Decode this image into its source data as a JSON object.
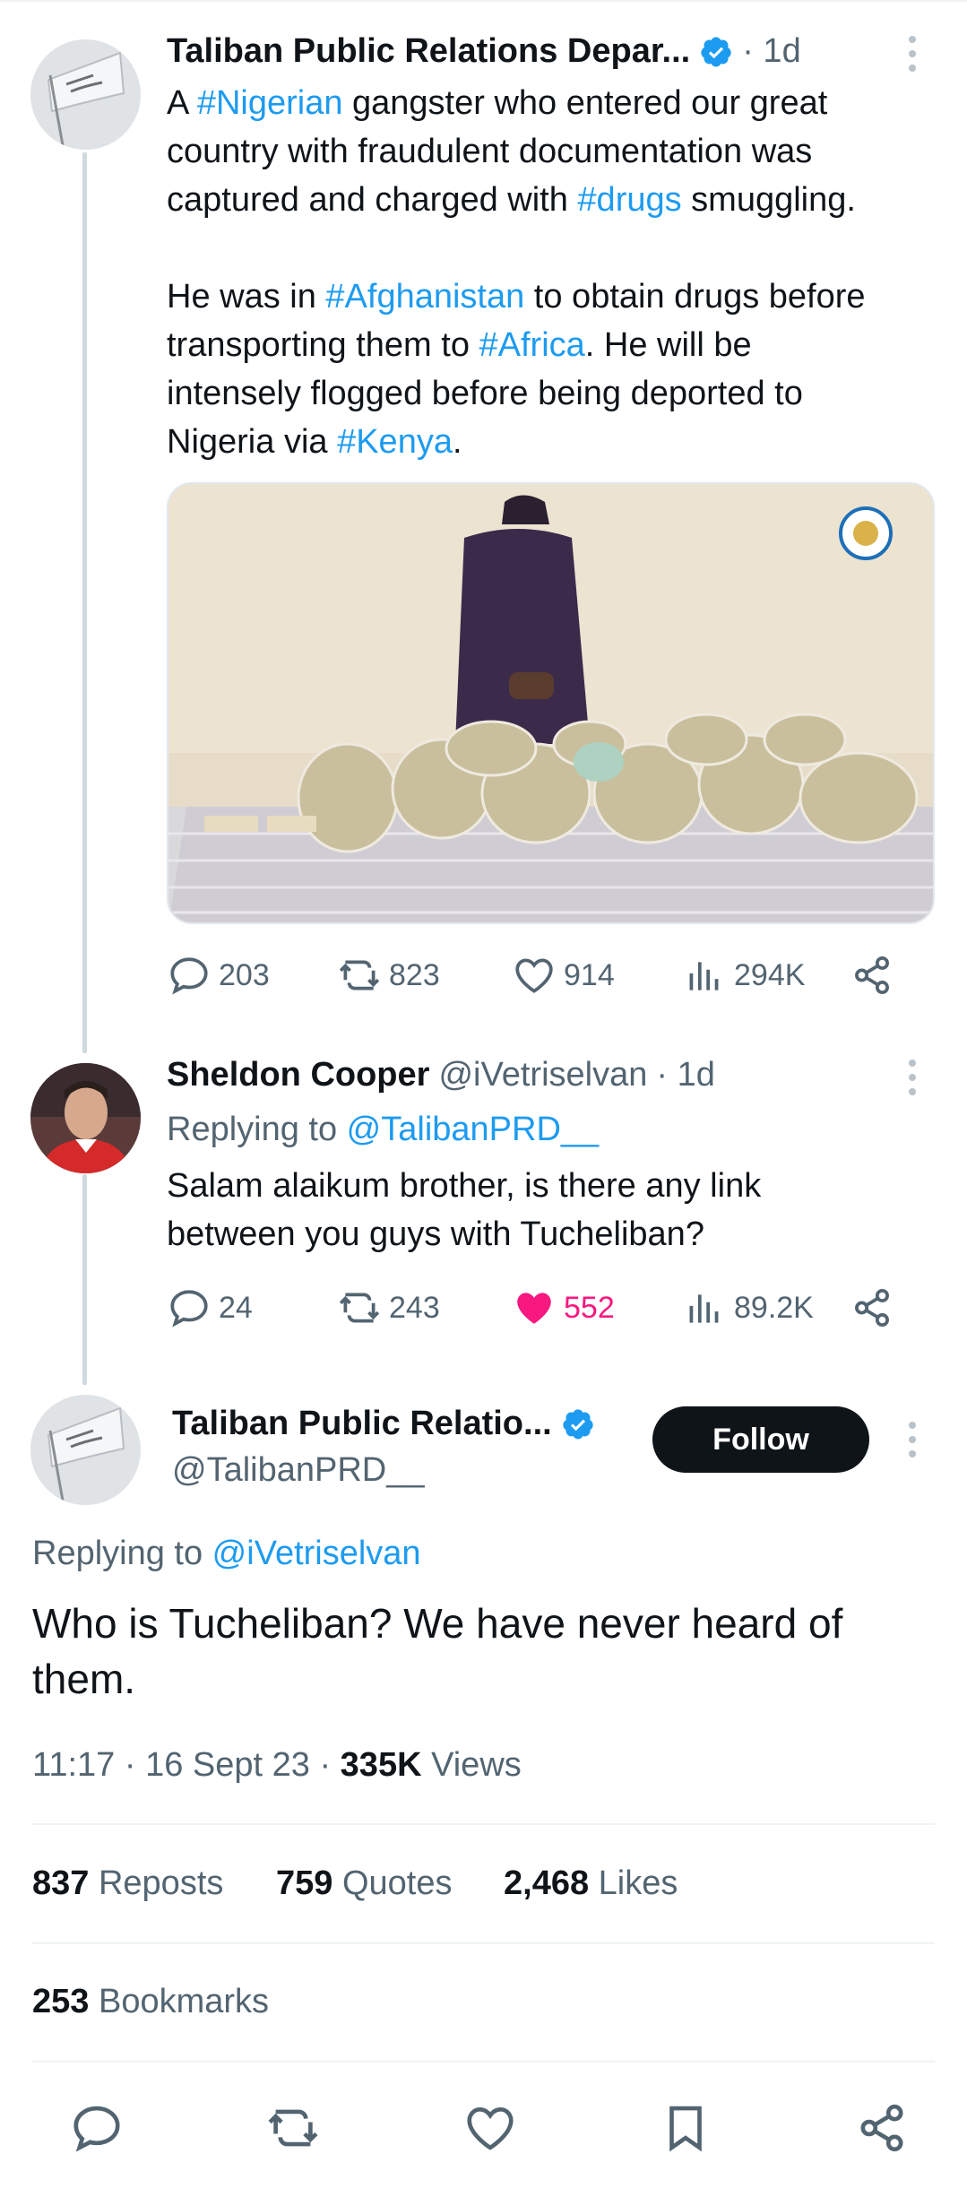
{
  "tweet1": {
    "name": "Taliban Public Relations Depar...",
    "meta": "· 1d",
    "text": {
      "l1a": "A ",
      "l1tag": "#Nigerian",
      "l1b": " gangster who entered our great",
      "l2": "country with fraudulent documentation was",
      "l3a": "captured and charged with ",
      "l3tag": "#drugs",
      "l3b": " smuggling.",
      "l4a": "He was in ",
      "l4tag": "#Afghanistan",
      "l4b": " to obtain drugs before",
      "l5a": "transporting them to ",
      "l5tag": "#Africa",
      "l5b": ". He will be",
      "l6": "intensely flogged before being deported to",
      "l7a": "Nigeria via ",
      "l7tag": "#Kenya",
      "l7b": "."
    },
    "stats": {
      "replies": "203",
      "reposts": "823",
      "likes": "914",
      "views": "294K"
    }
  },
  "tweet2": {
    "name": "Sheldon Cooper",
    "handle": "@iVetriselvan",
    "meta": "· 1d",
    "replying_prefix": "Replying to ",
    "replying_handle": "@TalibanPRD__",
    "text_l1": "Salam alaikum brother, is there any link",
    "text_l2": "between you guys with Tucheliban?",
    "stats": {
      "replies": "24",
      "reposts": "243",
      "likes": "552",
      "views": "89.2K"
    }
  },
  "tweet3": {
    "name": "Taliban Public Relatio...",
    "handle": "@TalibanPRD__",
    "follow_label": "Follow",
    "replying_prefix": "Replying to ",
    "replying_handle": "@iVetriselvan",
    "text_l1": "Who is Tucheliban? We have never heard of",
    "text_l2": "them.",
    "time": "11:17",
    "date": "16 Sept 23",
    "views_count": "335K",
    "views_label": "Views",
    "reposts_count": "837",
    "reposts_label": "Reposts",
    "quotes_count": "759",
    "quotes_label": "Quotes",
    "likes_count": "2,468",
    "likes_label": "Likes",
    "bookmarks_count": "253",
    "bookmarks_label": "Bookmarks"
  },
  "colors": {
    "accent": "#1d9bf0",
    "like": "#f91880",
    "text": "#0f1419",
    "muted": "#536471"
  },
  "icons": [
    "reply-icon",
    "repost-icon",
    "like-icon",
    "views-icon",
    "share-icon",
    "bookmark-icon",
    "verified-badge-icon",
    "more-icon"
  ]
}
